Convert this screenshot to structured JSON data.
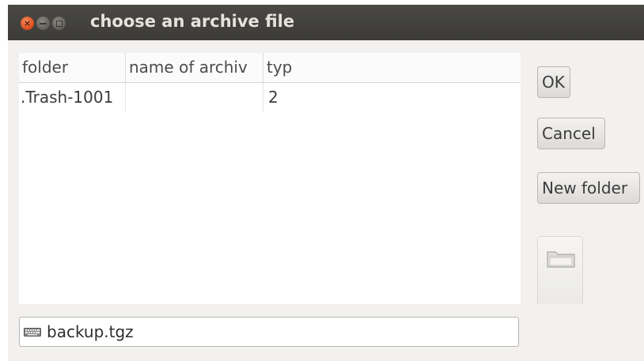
{
  "window": {
    "title": "choose an archive file"
  },
  "list": {
    "columns": [
      "folder",
      "name of archiv",
      "typ"
    ],
    "rows": [
      {
        "folder": ".Trash-1001",
        "name": "",
        "typ": "2"
      }
    ]
  },
  "buttons": {
    "ok_label": "OK",
    "cancel_label": "Cancel",
    "new_folder_label": "New folder"
  },
  "icons": {
    "close": "close-icon",
    "minimize": "minimize-icon",
    "maximize": "maximize-icon",
    "folder": "folder-icon",
    "keyboard": "keyboard-icon"
  },
  "filename_entry": {
    "value": "backup.tgz"
  },
  "colors": {
    "titlebar": "#3c3b37",
    "close_button": "#dc4b1a",
    "window_background": "#f2f1f0"
  }
}
